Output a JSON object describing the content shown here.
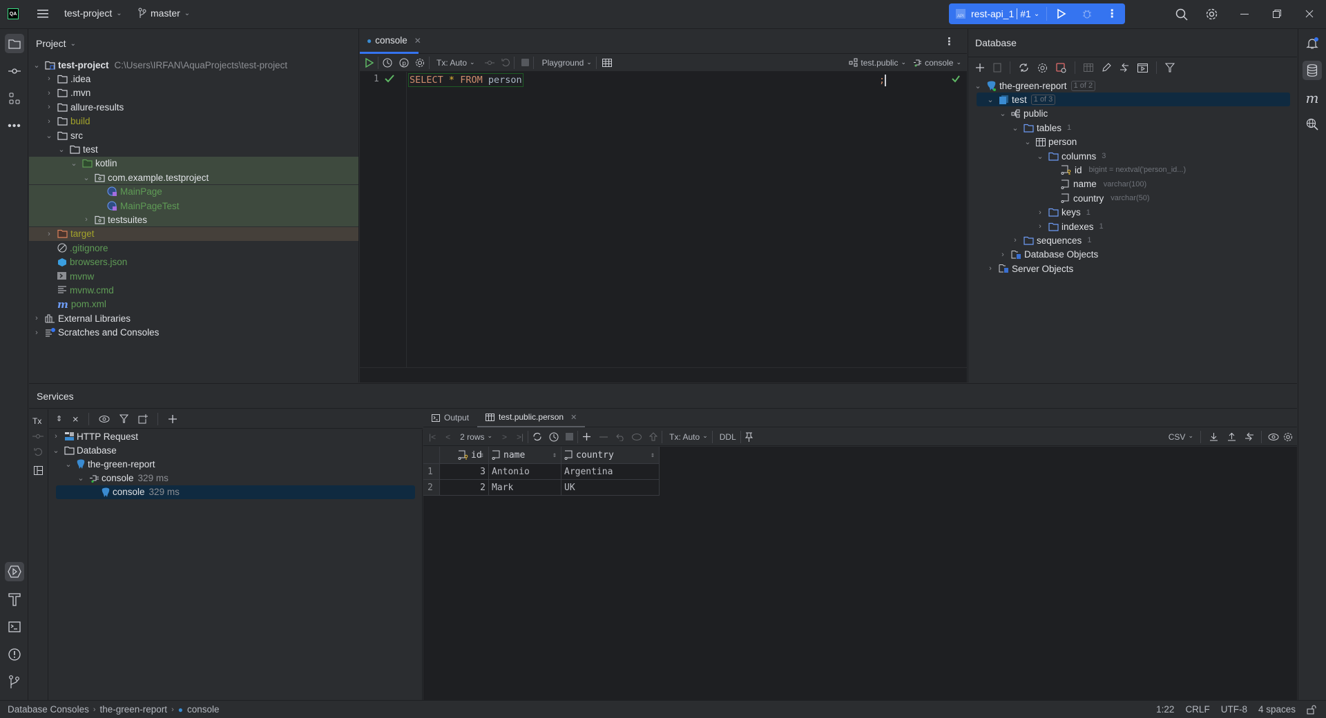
{
  "titlebar": {
    "project_name": "test-project",
    "branch": "master",
    "run_config": "rest-api_1",
    "run_config_number": "#1",
    "accent_color": "#3574f0"
  },
  "left_strip": {
    "items": [
      "project-icon",
      "commit-icon",
      "structure-icon",
      "more-icon"
    ],
    "bottom_items": [
      "services-icon",
      "build-icon",
      "terminal-icon",
      "problems-icon",
      "git-icon"
    ]
  },
  "project_panel": {
    "title": "Project",
    "root": {
      "name": "test-project",
      "path": "C:\\Users\\IRFAN\\AquaProjects\\test-project"
    },
    "items": [
      {
        "label": ".idea",
        "depth": 1,
        "type": "folder",
        "expanded": false
      },
      {
        "label": ".mvn",
        "depth": 1,
        "type": "folder",
        "expanded": false
      },
      {
        "label": "allure-results",
        "depth": 1,
        "type": "folder",
        "expanded": false
      },
      {
        "label": "build",
        "depth": 1,
        "type": "folder",
        "expanded": false,
        "color": "olive"
      },
      {
        "label": "src",
        "depth": 1,
        "type": "folder",
        "expanded": true
      },
      {
        "label": "test",
        "depth": 2,
        "type": "folder",
        "expanded": true
      },
      {
        "label": "kotlin",
        "depth": 3,
        "type": "source-folder",
        "expanded": true
      },
      {
        "label": "com.example.testproject",
        "depth": 4,
        "type": "package",
        "expanded": true
      },
      {
        "label": "MainPage",
        "depth": 5,
        "type": "kotlin-class",
        "color": "green"
      },
      {
        "label": "MainPageTest",
        "depth": 5,
        "type": "kotlin-class",
        "color": "green"
      },
      {
        "label": "testsuites",
        "depth": 4,
        "type": "package",
        "expanded": false
      },
      {
        "label": "target",
        "depth": 1,
        "type": "excluded-folder",
        "expanded": false,
        "color": "olive"
      },
      {
        "label": ".gitignore",
        "depth": 1,
        "type": "ignore-file",
        "color": "green"
      },
      {
        "label": "browsers.json",
        "depth": 1,
        "type": "json-file",
        "color": "green"
      },
      {
        "label": "mvnw",
        "depth": 1,
        "type": "shell-file",
        "color": "green"
      },
      {
        "label": "mvnw.cmd",
        "depth": 1,
        "type": "text-file",
        "color": "green"
      },
      {
        "label": "pom.xml",
        "depth": 1,
        "type": "maven-file",
        "color": "green"
      },
      {
        "label": "External Libraries",
        "depth": 0,
        "type": "libraries",
        "expanded": false
      },
      {
        "label": "Scratches and Consoles",
        "depth": 0,
        "type": "scratches",
        "expanded": false
      }
    ]
  },
  "editor": {
    "tab_label": "console",
    "toolbar": {
      "tx_mode": "Tx: Auto",
      "mode": "Playground",
      "schema": "test.public",
      "session": "console"
    },
    "line_number": "1",
    "code": {
      "kw1": "SELECT",
      "star": "*",
      "kw2": "FROM",
      "ident": "person",
      "semi": ";"
    }
  },
  "database_panel": {
    "title": "Database",
    "tree": [
      {
        "label": "the-green-report",
        "badge": "1 of 2",
        "depth": 0
      },
      {
        "label": "test",
        "badge": "1 of 3",
        "depth": 1,
        "selected": true
      },
      {
        "label": "public",
        "depth": 2
      },
      {
        "label": "tables",
        "count": "1",
        "depth": 3
      },
      {
        "label": "person",
        "depth": 4
      },
      {
        "label": "columns",
        "count": "3",
        "depth": 5
      },
      {
        "label": "id",
        "type": "bigint = nextval('person_id...)",
        "depth": 6
      },
      {
        "label": "name",
        "type": "varchar(100)",
        "depth": 6
      },
      {
        "label": "country",
        "type": "varchar(50)",
        "depth": 6
      },
      {
        "label": "keys",
        "count": "1",
        "depth": 5
      },
      {
        "label": "indexes",
        "count": "1",
        "depth": 5
      },
      {
        "label": "sequences",
        "count": "1",
        "depth": 3
      },
      {
        "label": "Database Objects",
        "depth": 2
      },
      {
        "label": "Server Objects",
        "depth": 1
      }
    ]
  },
  "services": {
    "title": "Services",
    "tree": [
      {
        "label": "HTTP Request",
        "depth": 0
      },
      {
        "label": "Database",
        "depth": 0
      },
      {
        "label": "the-green-report",
        "depth": 1
      },
      {
        "label": "console",
        "time": "329 ms",
        "depth": 2
      },
      {
        "label": "console",
        "time": "329 ms",
        "depth": 3,
        "selected": true
      }
    ],
    "tabs": [
      {
        "label": "Output"
      },
      {
        "label": "test.public.person",
        "active": true
      }
    ],
    "results_toolbar": {
      "rows": "2 rows",
      "tx_mode": "Tx: Auto",
      "ddl": "DDL",
      "export_format": "CSV"
    },
    "grid": {
      "columns": [
        "id",
        "name",
        "country"
      ],
      "rows": [
        {
          "num": "1",
          "id": "3",
          "name": "Antonio",
          "country": "Argentina"
        },
        {
          "num": "2",
          "id": "2",
          "name": "Mark",
          "country": "UK"
        }
      ]
    }
  },
  "statusbar": {
    "breadcrumbs": [
      "Database Consoles",
      "the-green-report",
      "console"
    ],
    "position": "1:22",
    "line_sep": "CRLF",
    "encoding": "UTF-8",
    "indent": "4 spaces"
  }
}
